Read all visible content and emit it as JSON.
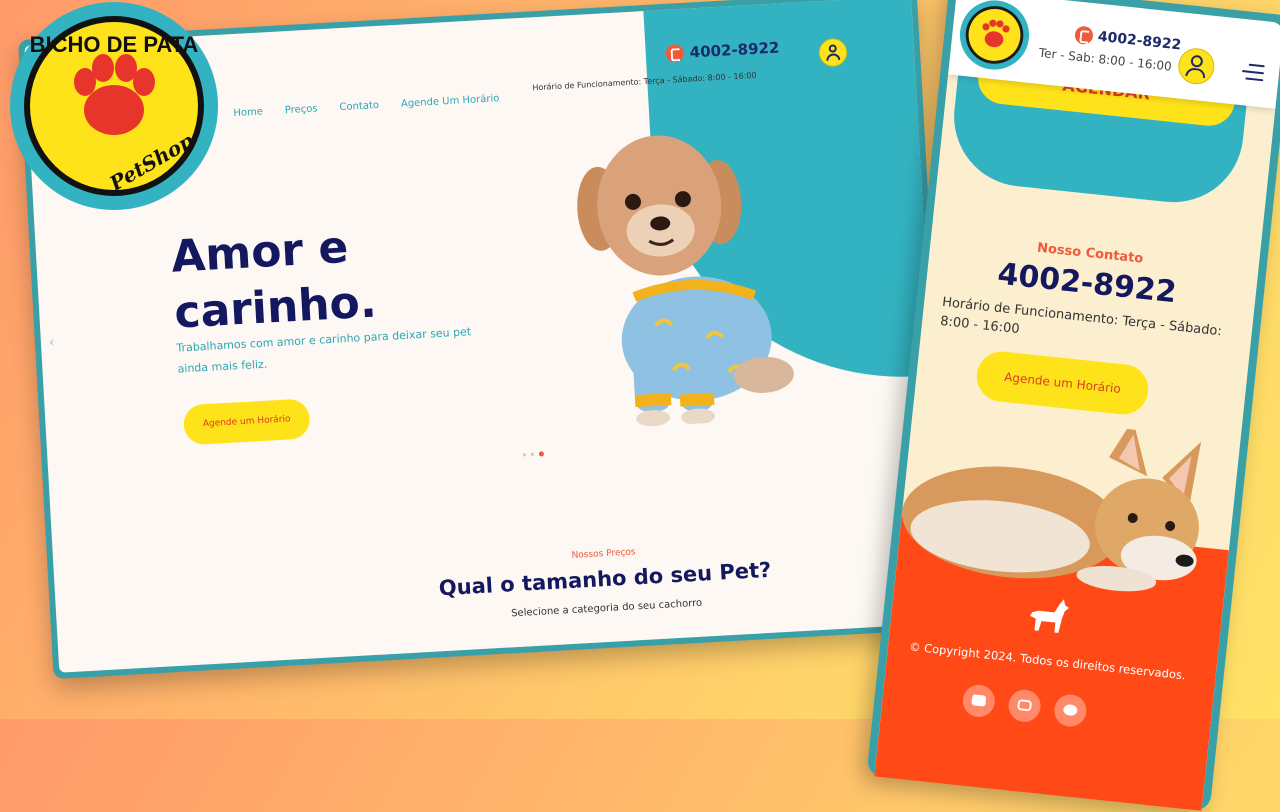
{
  "brand": {
    "logo_top": "BICHO DE PATA",
    "logo_bottom": "PetShop",
    "colors": {
      "primary_navy": "#14195f",
      "teal": "#33b3c1",
      "yellow": "#ffe31a",
      "orange": "#f05a3a",
      "footer_orange": "#ff4a17"
    }
  },
  "desktop": {
    "nav": [
      "Home",
      "Preços",
      "Contato",
      "Agende Um Horário"
    ],
    "hours": "Horário de Funcionamento: Terça - Sábado: 8:00 - 16:00",
    "phone": "4002-8922",
    "hero": {
      "title": "Amor e carinho.",
      "subtitle": "Trabalhamos com amor e carinho para deixar seu pet ainda mais feliz.",
      "cta": "Agende um Horário"
    },
    "carousel": {
      "slides": 3,
      "active": 3
    },
    "pricing": {
      "kicker": "Nossos Preços",
      "title": "Qual o tamanho do seu Pet?",
      "subtitle": "Selecione a categoria do seu cachorro"
    }
  },
  "mobile": {
    "header": {
      "phone": "4002-8922",
      "hours": "Ter - Sab: 8:00 - 16:00"
    },
    "agendar": "AGENDAR",
    "contact": {
      "kicker": "Nosso Contato",
      "phone": "4002-8922",
      "hours": "Horário de Funcionamento: Terça - Sábado: 8:00 - 16:00",
      "cta": "Agende um Horário"
    },
    "footer": {
      "copyright": "© Copyright 2024. Todos os direitos reservados.",
      "socials": [
        "youtube-icon",
        "instagram-icon",
        "github-icon"
      ]
    }
  },
  "icons": [
    "phone-icon",
    "user-icon",
    "menu-icon",
    "dog-icon"
  ]
}
